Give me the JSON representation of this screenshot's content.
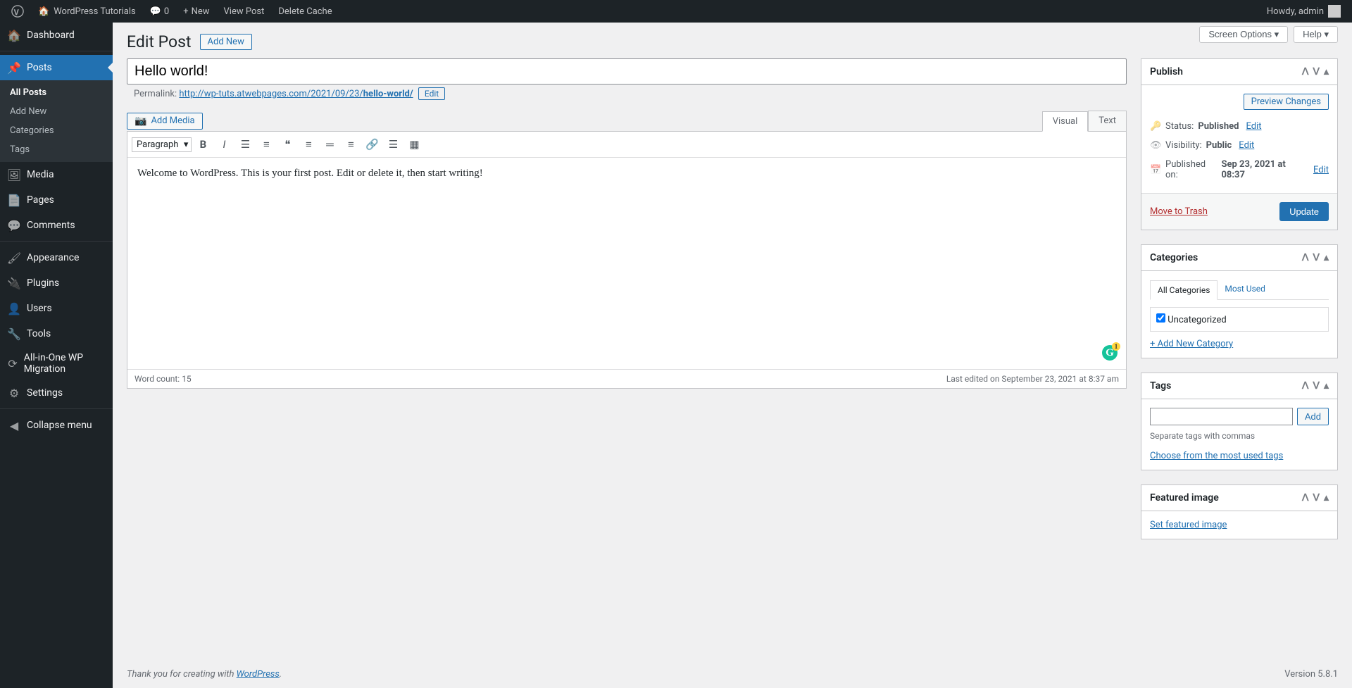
{
  "adminbar": {
    "site_name": "WordPress Tutorials",
    "comments_count": "0",
    "new_label": "New",
    "view_post": "View Post",
    "delete_cache": "Delete Cache",
    "howdy": "Howdy, admin"
  },
  "top_buttons": {
    "screen_options": "Screen Options",
    "help": "Help"
  },
  "heading": {
    "title": "Edit Post",
    "add_new": "Add New"
  },
  "sidebar": {
    "items": [
      {
        "label": "Dashboard"
      },
      {
        "label": "Posts",
        "current": true,
        "sub": [
          "All Posts",
          "Add New",
          "Categories",
          "Tags"
        ]
      },
      {
        "label": "Media"
      },
      {
        "label": "Pages"
      },
      {
        "label": "Comments"
      },
      {
        "label": "Appearance"
      },
      {
        "label": "Plugins"
      },
      {
        "label": "Users"
      },
      {
        "label": "Tools"
      },
      {
        "label": "All-in-One WP Migration"
      },
      {
        "label": "Settings"
      },
      {
        "label": "Collapse menu"
      }
    ]
  },
  "post": {
    "title": "Hello world!",
    "permalink_label": "Permalink:",
    "permalink_base": "http://wp-tuts.atwebpages.com/2021/09/23/",
    "slug": "hello-world/",
    "edit_btn": "Edit",
    "content": "Welcome to WordPress. This is your first post. Edit or delete it, then start writing!"
  },
  "media_btn": "Add Media",
  "editor_tabs": {
    "visual": "Visual",
    "text": "Text"
  },
  "format_select": "Paragraph",
  "status_bar": {
    "word_count_label": "Word count: ",
    "word_count": "15",
    "last_edited": "Last edited on September 23, 2021 at 8:37 am"
  },
  "publish_box": {
    "title": "Publish",
    "preview": "Preview Changes",
    "status_label": "Status:",
    "status_value": "Published",
    "visibility_label": "Visibility:",
    "visibility_value": "Public",
    "published_label": "Published on:",
    "published_value": "Sep 23, 2021 at 08:37",
    "edit": "Edit",
    "trash": "Move to Trash",
    "update": "Update"
  },
  "categories_box": {
    "title": "Categories",
    "tab_all": "All Categories",
    "tab_used": "Most Used",
    "item": "Uncategorized",
    "add_new": "+ Add New Category"
  },
  "tags_box": {
    "title": "Tags",
    "add": "Add",
    "hint": "Separate tags with commas",
    "choose": "Choose from the most used tags"
  },
  "featured_box": {
    "title": "Featured image",
    "set": "Set featured image"
  },
  "footer": {
    "thanks_prefix": "Thank you for creating with ",
    "wordpress": "WordPress",
    "version": "Version 5.8.1"
  }
}
